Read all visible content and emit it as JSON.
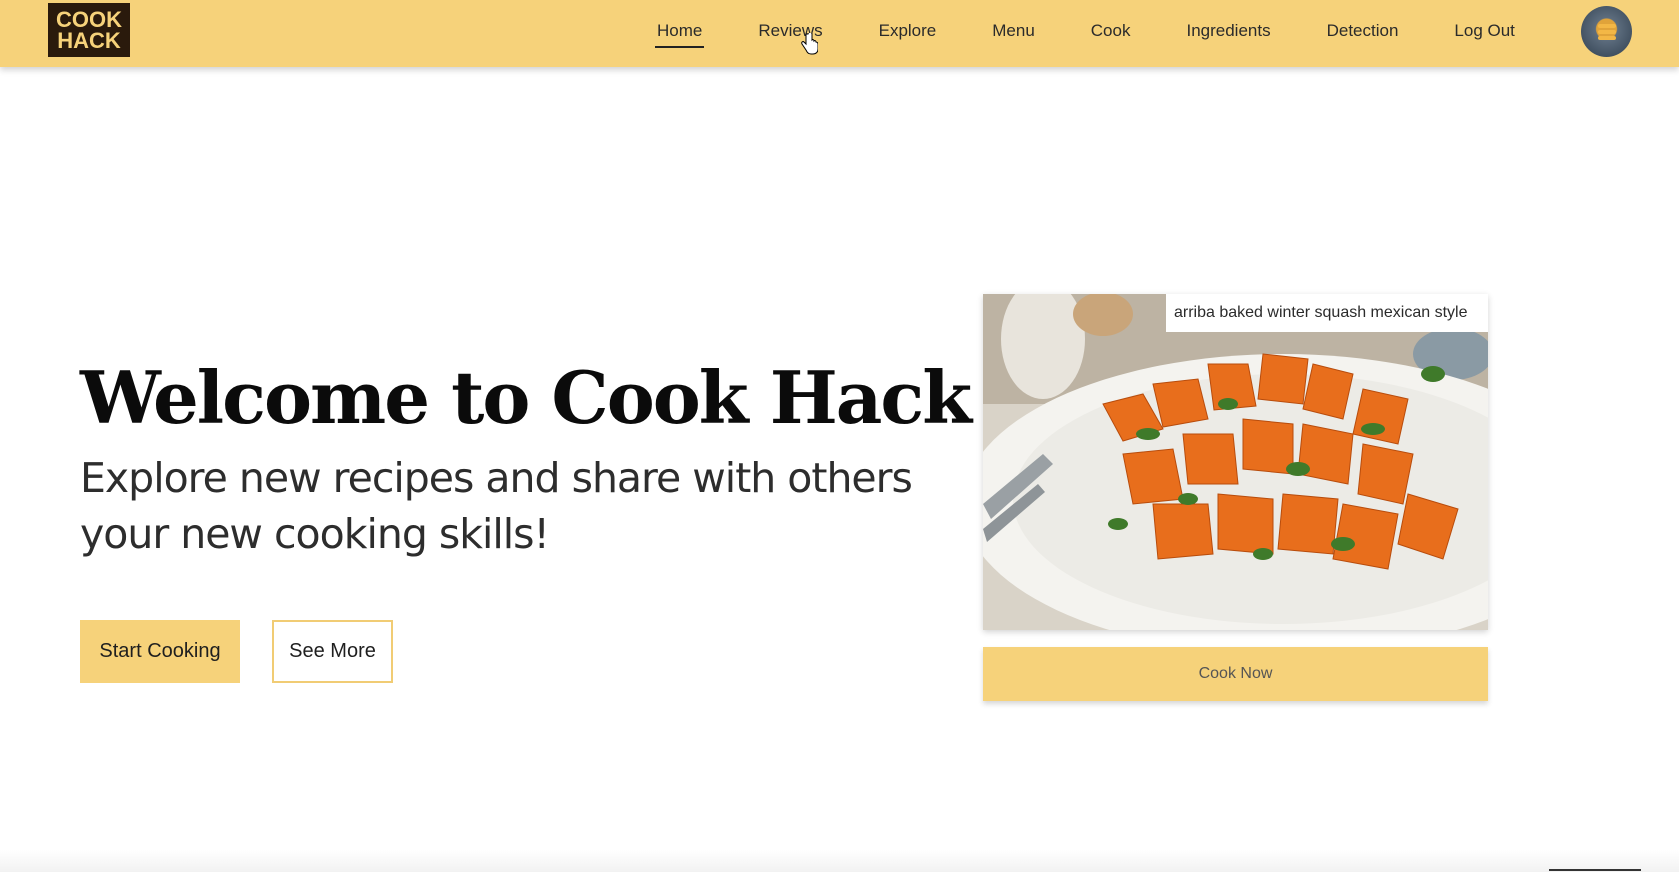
{
  "header": {
    "logo_line1": "COOK",
    "logo_line2": "HACK",
    "nav": {
      "home": "Home",
      "reviews": "Reviews",
      "explore": "Explore",
      "menu": "Menu",
      "cook": "Cook",
      "ingredients": "Ingredients",
      "detection": "Detection",
      "logout": "Log Out"
    },
    "active_item": "Home"
  },
  "hero": {
    "title": "Welcome to Cook Hack",
    "subtitle_line1": "Explore new recipes and share with others",
    "subtitle_line2": "your new cooking skills!",
    "primary_button": "Start Cooking",
    "secondary_button": "See More"
  },
  "recipe_card": {
    "caption": "arriba baked winter squash mexican style",
    "action_button": "Cook Now"
  },
  "colors": {
    "accent": "#f6d27a",
    "logo_bg": "#2a1a0c",
    "text": "#1a1a1a"
  },
  "icons": {
    "profile": "avatar-icon",
    "pointer": "hand-pointer-icon"
  }
}
